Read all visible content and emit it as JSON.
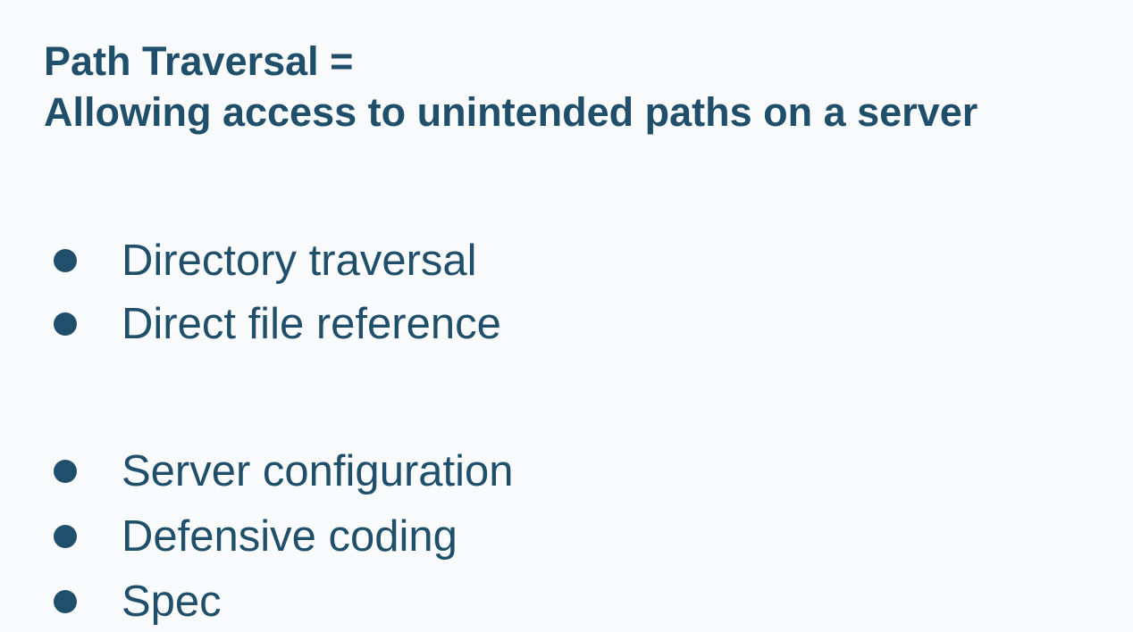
{
  "slide": {
    "title_lines": [
      "Path Traversal =",
      "Allowing access to unintended paths on a server"
    ],
    "bullets": [
      "Directory traversal",
      "Direct file reference",
      "Server configuration",
      "Defensive coding",
      "Spec"
    ]
  },
  "colors": {
    "background": "#f9fafb",
    "text": "#1f4f6b",
    "bullet": "#1f4f6b"
  }
}
